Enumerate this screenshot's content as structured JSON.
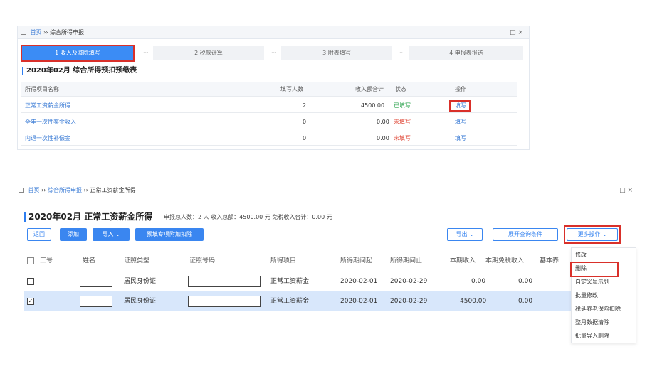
{
  "top_window": {
    "breadcrumb": [
      "首页",
      "综合所得申报"
    ],
    "controls": "□ ×",
    "steps": [
      "1 收入及减除填写",
      "2 税款计算",
      "3 附表填写",
      "4 申报表报送"
    ],
    "step_separator": "···",
    "title": "2020年02月  综合所得预扣预缴表",
    "columns": [
      "所得项目名称",
      "填写人数",
      "收入额合计",
      "状态",
      "操作"
    ],
    "rows": [
      {
        "name": "正常工资薪金所得",
        "count": "2",
        "amount": "4500.00",
        "status": "已填写",
        "action": "填写"
      },
      {
        "name": "全年一次性奖金收入",
        "count": "0",
        "amount": "0.00",
        "status": "未填写",
        "action": "填写"
      },
      {
        "name": "内退一次性补偿金",
        "count": "0",
        "amount": "0.00",
        "status": "未填写",
        "action": "填写"
      }
    ]
  },
  "bottom_window": {
    "breadcrumb": [
      "首页",
      "综合所得申报",
      "正常工资薪金所得"
    ],
    "controls": "□ ×",
    "title": "2020年02月 正常工资薪金所得",
    "summary": "申报总人数：2 人  收入总额：4500.00 元  免税收入合计：0.00 元",
    "buttons": {
      "back": "返回",
      "add": "添加",
      "import": "导入",
      "prefill": "预填专项附加扣除",
      "export": "导出",
      "expand": "展开查询条件",
      "more": "更多操作"
    },
    "columns": [
      "工号",
      "姓名",
      "证照类型",
      "证照号码",
      "所得项目",
      "所得期间起",
      "所得期间止",
      "本期收入",
      "本期免税收入",
      "基本养"
    ],
    "rows": [
      {
        "id_type": "居民身份证",
        "income_item": "正常工资薪金",
        "start": "2020-02-01",
        "end": "2020-02-29",
        "income": "0.00",
        "tax_free": "0.00",
        "checked": false
      },
      {
        "id_type": "居民身份证",
        "income_item": "正常工资薪金",
        "start": "2020-02-01",
        "end": "2020-02-29",
        "income": "4500.00",
        "tax_free": "0.00",
        "checked": true
      }
    ],
    "more_menu": [
      "修改",
      "删除",
      "自定义显示列",
      "批量修改",
      "税延养老保险扣除",
      "整月数据清除",
      "批量导入删除"
    ]
  },
  "colors": {
    "accent": "#3a86f0",
    "highlight": "#d9302a",
    "selected_row": "#d8e7fb"
  }
}
